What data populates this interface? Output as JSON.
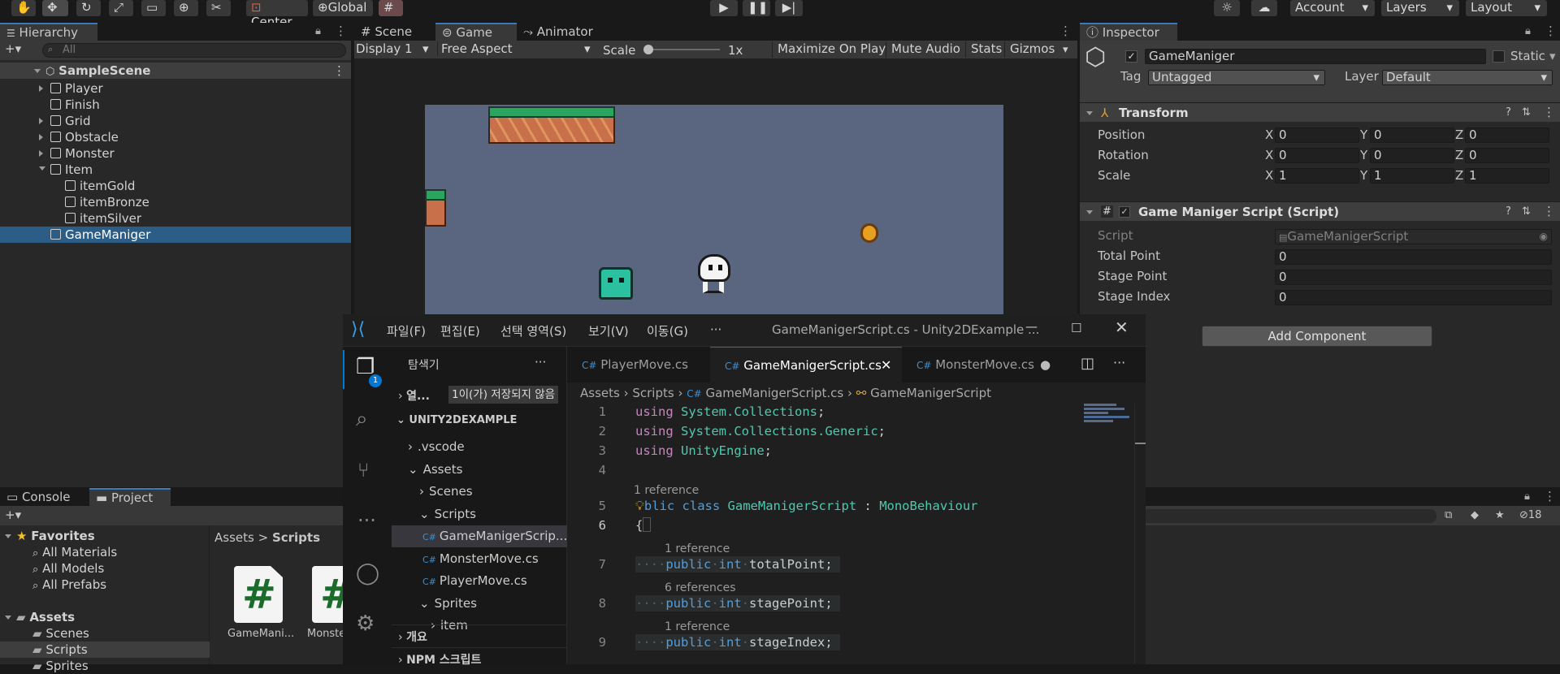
{
  "toolbar": {
    "center_label": "Center",
    "global_label": "Global",
    "account_label": "Account",
    "layers_label": "Layers",
    "layout_label": "Layout"
  },
  "hierarchy": {
    "tab_label": "Hierarchy",
    "search_placeholder": "All",
    "scene_name": "SampleScene",
    "items": [
      {
        "label": "Player"
      },
      {
        "label": "Finish"
      },
      {
        "label": "Grid"
      },
      {
        "label": "Obstacle"
      },
      {
        "label": "Monster"
      },
      {
        "label": "Item"
      },
      {
        "label": "itemGold"
      },
      {
        "label": "itemBronze"
      },
      {
        "label": "itemSilver"
      },
      {
        "label": "GameManiger"
      }
    ]
  },
  "view_tabs": {
    "scene": "Scene",
    "game": "Game",
    "animator": "Animator"
  },
  "game_toolbar": {
    "display": "Display 1",
    "aspect": "Free Aspect",
    "scale_label": "Scale",
    "scale_value": "1x",
    "maximize": "Maximize On Play",
    "mute": "Mute Audio",
    "stats": "Stats",
    "gizmos": "Gizmos"
  },
  "inspector": {
    "tab_label": "Inspector",
    "object_name": "GameManiger",
    "static_label": "Static",
    "tag_label": "Tag",
    "tag_value": "Untagged",
    "layer_label": "Layer",
    "layer_value": "Default",
    "transform_title": "Transform",
    "transform_rows": [
      {
        "label": "Position",
        "x": "0",
        "y": "0",
        "z": "0"
      },
      {
        "label": "Rotation",
        "x": "0",
        "y": "0",
        "z": "0"
      },
      {
        "label": "Scale",
        "x": "1",
        "y": "1",
        "z": "1"
      }
    ],
    "axis_x": "X",
    "axis_y": "Y",
    "axis_z": "Z",
    "script_title": "Game Maniger Script (Script)",
    "script_label": "Script",
    "script_value": "GameManigerScript",
    "fields": [
      {
        "label": "Total Point",
        "value": "0"
      },
      {
        "label": "Stage Point",
        "value": "0"
      },
      {
        "label": "Stage Index",
        "value": "0"
      }
    ],
    "add_component": "Add Component"
  },
  "bottom": {
    "console_tab": "Console",
    "project_tab": "Project",
    "favorites_label": "Favorites",
    "favorites": [
      "All Materials",
      "All Models",
      "All Prefabs"
    ],
    "assets_label": "Assets",
    "assets_children": [
      "Scenes",
      "Scripts",
      "Sprites"
    ],
    "breadcrumb_root": "Assets",
    "breadcrumb_current": "Scripts",
    "file1": "GameMani...",
    "file2": "Monste",
    "count": "18"
  },
  "vscode": {
    "menus": [
      "파일(F)",
      "편집(E)",
      "선택 영역(S)",
      "보기(V)",
      "이동(G)",
      "···"
    ],
    "title": "GameManigerScript.cs - Unity2DExample ...",
    "explorer_title": "탐색기",
    "open_editors": "열...",
    "unsaved_badge": "1이(가) 저장되지 않음",
    "workspace": "UNITY2DEXAMPLE",
    "tree": [
      {
        "label": ".vscode"
      },
      {
        "label": "Assets"
      },
      {
        "label": "Scenes"
      },
      {
        "label": "Scripts"
      },
      {
        "label": "GameManigerScrip..."
      },
      {
        "label": "MonsterMove.cs"
      },
      {
        "label": "PlayerMove.cs"
      },
      {
        "label": "Sprites"
      },
      {
        "label": "item"
      }
    ],
    "outline": "개요",
    "npm": "NPM 스크립트",
    "tabs": [
      {
        "label": "PlayerMove.cs"
      },
      {
        "label": "GameManigerScript.cs"
      },
      {
        "label": "MonsterMove.cs"
      }
    ],
    "breadcrumb": [
      "Assets",
      "Scripts",
      "GameManigerScript.cs",
      "GameManigerScript"
    ],
    "badge_count": "1",
    "references": [
      "1 reference",
      "1 reference",
      "6 references",
      "1 reference"
    ],
    "line_numbers": [
      "1",
      "2",
      "3",
      "4",
      "5",
      "6",
      "7",
      "8",
      "9"
    ],
    "code": {
      "l1_kw": "using",
      "l1_ns": "System.Collections",
      "l2_kw": "using",
      "l2_ns1": "System.Collections.",
      "l2_ns2": "Generic",
      "l3_kw": "using",
      "l3_ns": "UnityEngine",
      "l5_a": "blic",
      "l5_b": "class",
      "l5_c": "GameManigerScript",
      "l5_d": " : ",
      "l5_e": "MonoBehaviour",
      "l6": "{",
      "l7_a": "public",
      "l7_b": "int",
      "l7_c": "totalPoint;",
      "l8_a": "public",
      "l8_b": "int",
      "l8_c": "stagePoint;",
      "l9_a": "public",
      "l9_b": "int",
      "l9_c": "stageIndex;"
    }
  }
}
